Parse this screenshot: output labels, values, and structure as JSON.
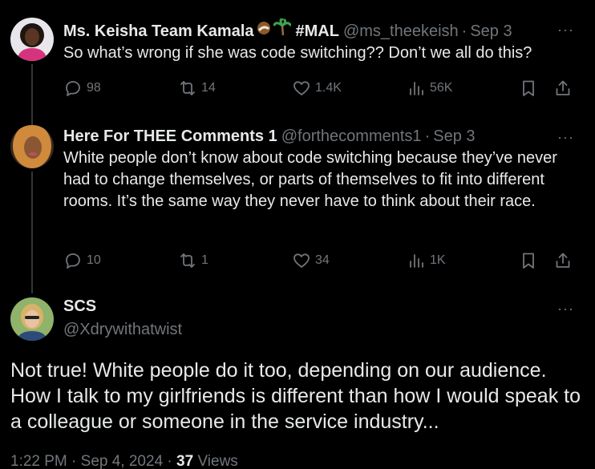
{
  "tweets": [
    {
      "name": "Ms. Keisha Team Kamala",
      "emoji1": "🥥",
      "emoji2": "🌴",
      "tag": "#MAL",
      "handle": "@ms_theekeish",
      "dot": "·",
      "date": "Sep 3",
      "text": "So what’s wrong if she was code switching?? Don’t we all do this?",
      "replies": "98",
      "reposts": "14",
      "likes": "1.4K",
      "views": "56K",
      "more": "···"
    },
    {
      "name": "Here For THEE Comments 1",
      "handle": "@forthecomments1",
      "dot": "·",
      "date": "Sep 3",
      "text": "White people don’t know about code switching because they’ve never had to change themselves, or parts of themselves to fit into different rooms. It’s the same way they never have to think about their race.",
      "replies": "10",
      "reposts": "1",
      "likes": "34",
      "views": "1K",
      "more": "···"
    }
  ],
  "main": {
    "name": "SCS",
    "handle": "@Xdrywithatwist",
    "more": "···",
    "text": "Not true! White people do it too, depending on our audience. How I talk to my girlfriends is different than how I would speak to a colleague or someone in the service industry...",
    "time": "1:22 PM",
    "sep1": "·",
    "date": "Sep 4, 2024",
    "sep2": "·",
    "views_count": "37",
    "views_label": "Views"
  },
  "colors": {
    "background": "#000000",
    "text": "#e7e9ea",
    "muted": "#71767b",
    "thread_line": "#333639"
  }
}
